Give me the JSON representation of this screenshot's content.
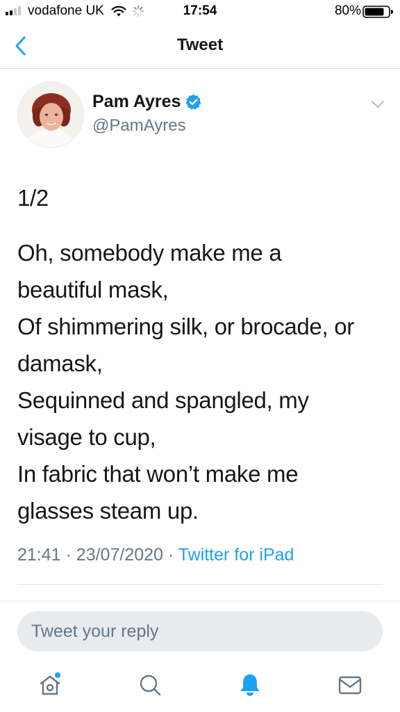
{
  "status_bar": {
    "carrier": "vodafone UK",
    "time": "17:54",
    "battery_percent": "80%"
  },
  "nav": {
    "title": "Tweet"
  },
  "tweet": {
    "author_name": "Pam Ayres",
    "author_handle": "@PamAyres",
    "lines": [
      "1/2",
      "Oh, somebody make me a",
      "beautiful mask,",
      "Of shimmering silk, or brocade, or",
      "damask,",
      "Sequinned and spangled, my",
      "visage to cup,",
      "In fabric that won’t make me",
      "glasses steam up."
    ],
    "time": "21:41",
    "date": "23/07/2020",
    "source": "Twitter for iPad"
  },
  "reply": {
    "placeholder": "Tweet your reply"
  },
  "colors": {
    "accent": "#1da1f2",
    "text": "#14171a",
    "secondary_text": "#657786",
    "reply_background": "#e6ecf0"
  },
  "icons": {
    "back": "chevron-left-icon",
    "verified": "verified-badge-icon",
    "caret": "chevron-down-icon",
    "home": "home-icon",
    "search": "search-icon",
    "notifications": "bell-icon",
    "messages": "envelope-icon"
  }
}
